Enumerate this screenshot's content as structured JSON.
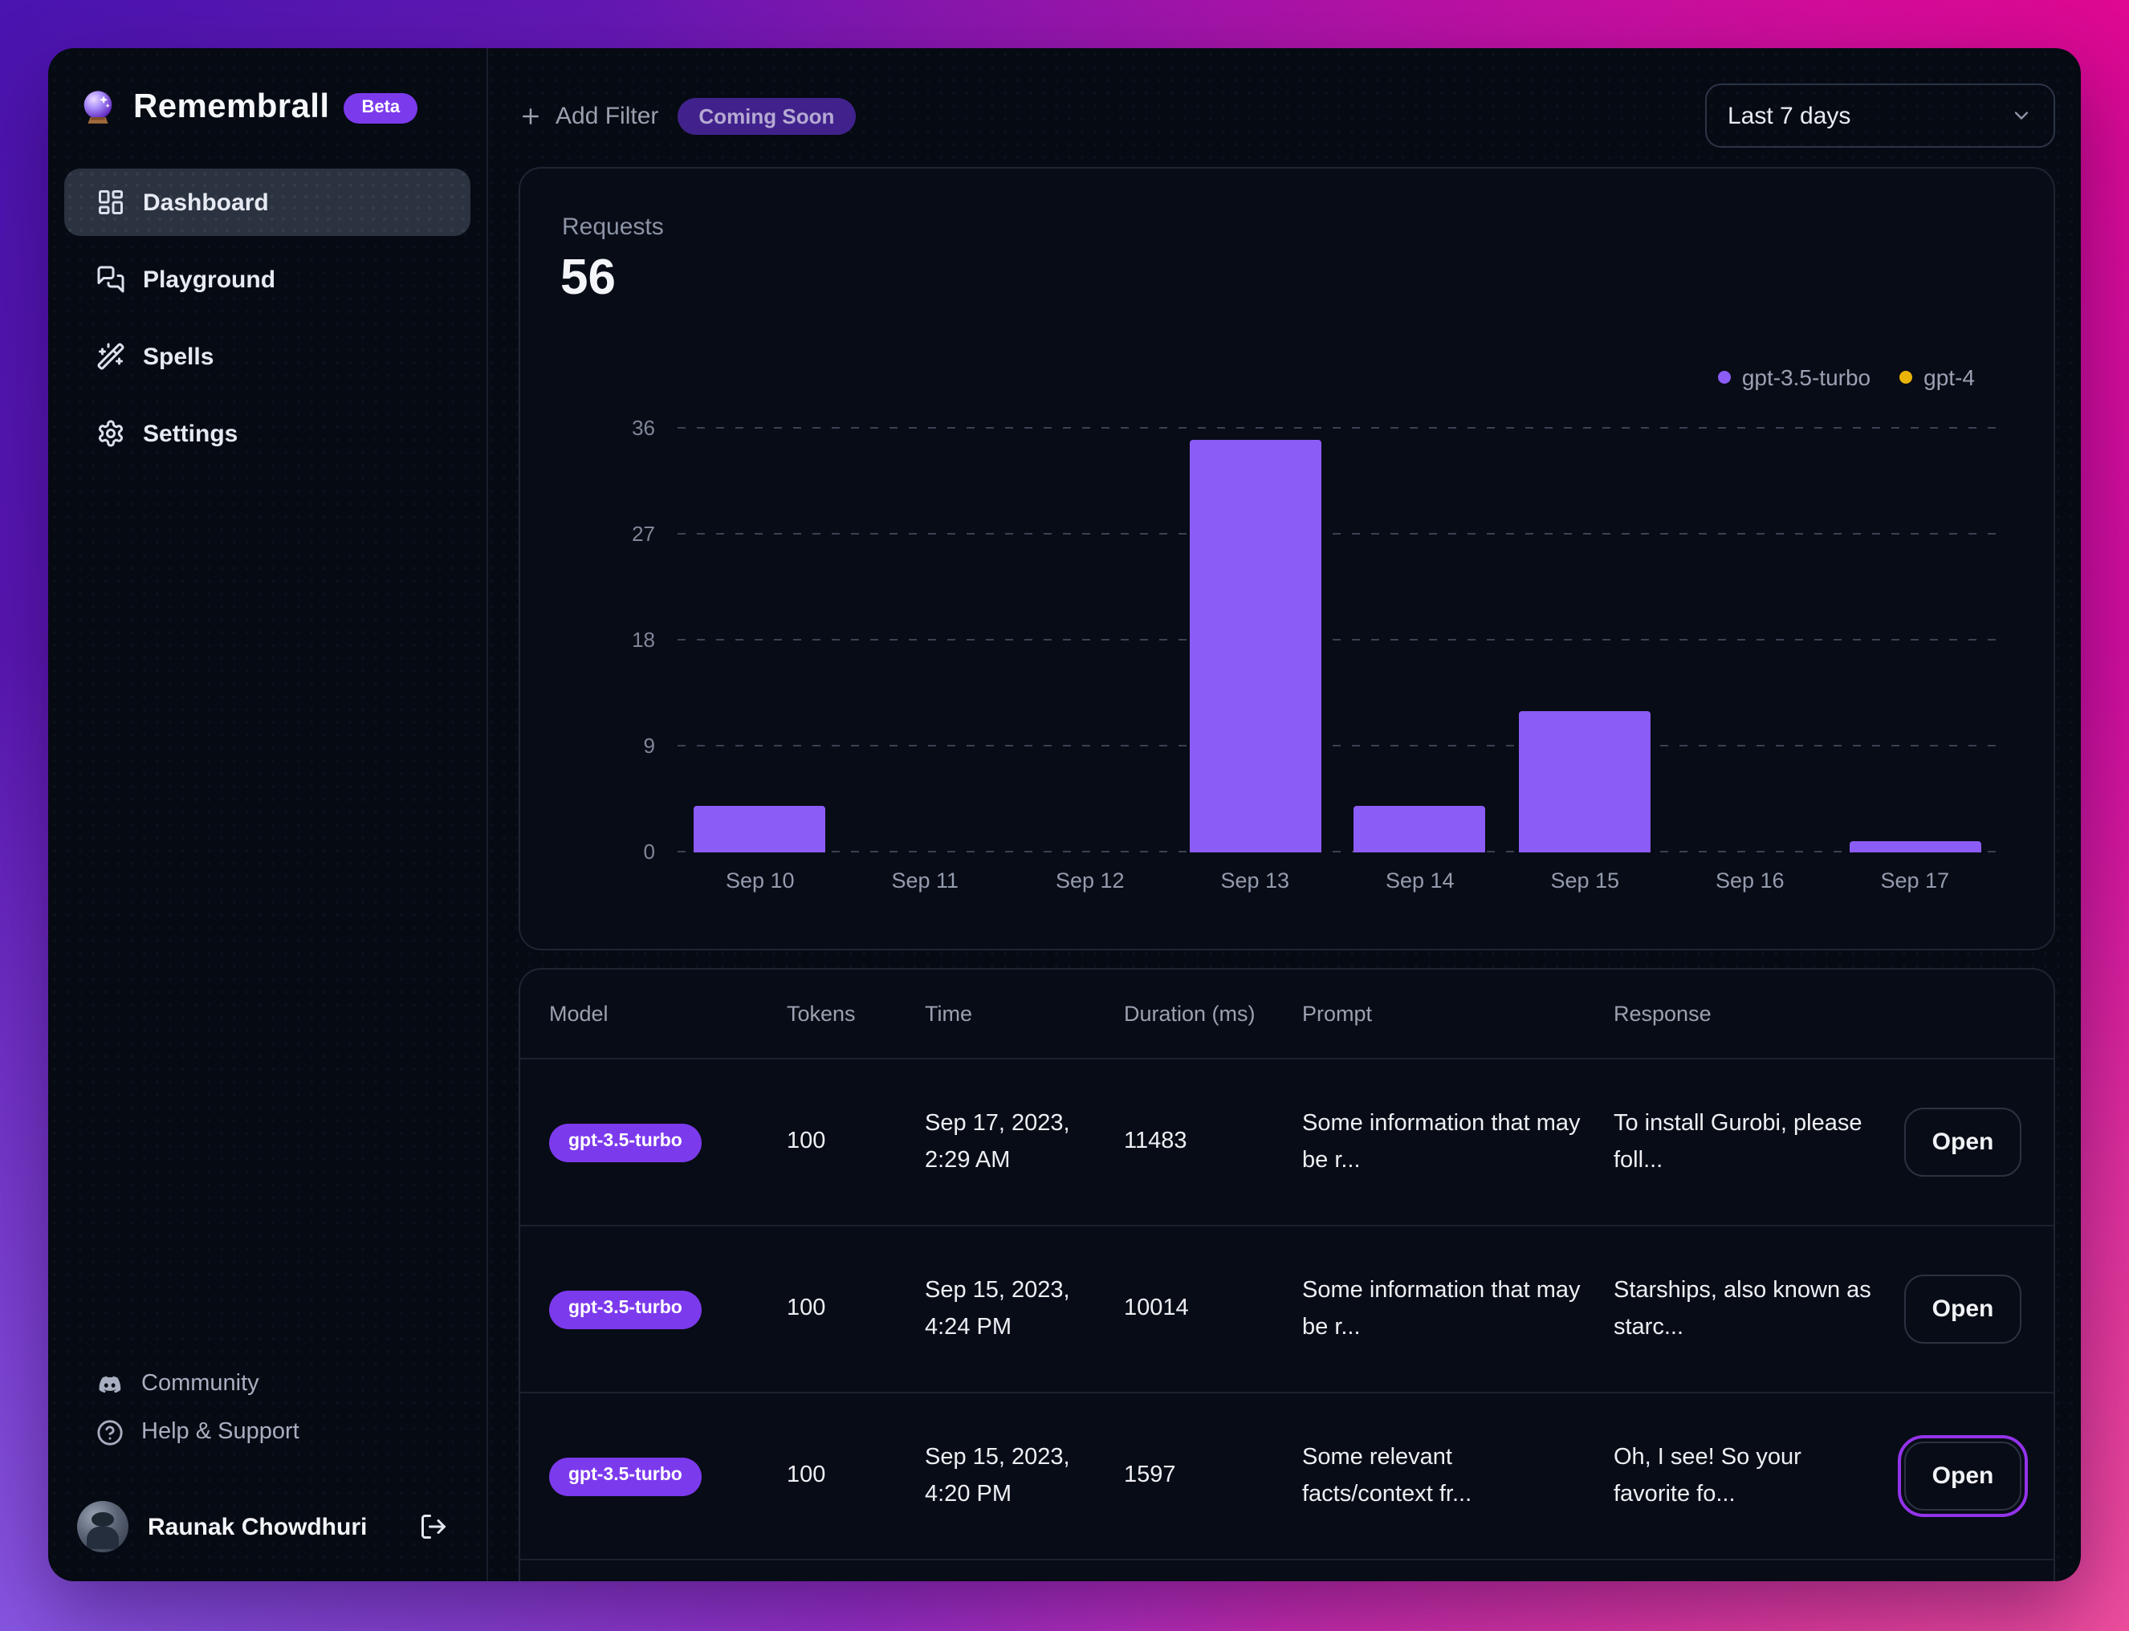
{
  "app": {
    "name": "Remembrall",
    "badge": "Beta"
  },
  "sidebar": {
    "nav": [
      {
        "label": "Dashboard",
        "icon": "dashboard-icon",
        "active": true
      },
      {
        "label": "Playground",
        "icon": "playground-icon",
        "active": false
      },
      {
        "label": "Spells",
        "icon": "spells-icon",
        "active": false
      },
      {
        "label": "Settings",
        "icon": "settings-icon",
        "active": false
      }
    ],
    "footer": [
      {
        "label": "Community",
        "icon": "discord-icon"
      },
      {
        "label": "Help & Support",
        "icon": "help-icon"
      }
    ],
    "user": {
      "name": "Raunak Chowdhuri"
    }
  },
  "topbar": {
    "add_filter": "Add Filter",
    "coming_soon": "Coming Soon",
    "date_range": "Last 7 days"
  },
  "chart_data": {
    "type": "bar",
    "title": "Requests",
    "total": "56",
    "categories": [
      "Sep 10",
      "Sep 11",
      "Sep 12",
      "Sep 13",
      "Sep 14",
      "Sep 15",
      "Sep 16",
      "Sep 17"
    ],
    "series": [
      {
        "name": "gpt-3.5-turbo",
        "color": "#8b5cf6",
        "values": [
          4,
          0,
          0,
          35,
          4,
          12,
          0,
          1
        ]
      },
      {
        "name": "gpt-4",
        "color": "#eab308",
        "values": [
          0,
          0,
          0,
          0,
          0,
          0,
          0,
          0
        ]
      }
    ],
    "ylim": [
      0,
      36
    ],
    "yticks": [
      0,
      9,
      18,
      27,
      36
    ],
    "grid": "horizontal-dashed",
    "legend_position": "top-right"
  },
  "table": {
    "columns": [
      "Model",
      "Tokens",
      "Time",
      "Duration (ms)",
      "Prompt",
      "Response",
      ""
    ],
    "open_label": "Open",
    "rows": [
      {
        "model": "gpt-3.5-turbo",
        "tokens": "100",
        "time": "Sep 17, 2023, 2:29 AM",
        "duration": "11483",
        "prompt": "Some information that may be r...",
        "response": "To install Gurobi, please foll...",
        "open_highlighted": false
      },
      {
        "model": "gpt-3.5-turbo",
        "tokens": "100",
        "time": "Sep 15, 2023, 4:24 PM",
        "duration": "10014",
        "prompt": "Some information that may be r...",
        "response": "Starships, also known as starc...",
        "open_highlighted": false
      },
      {
        "model": "gpt-3.5-turbo",
        "tokens": "100",
        "time": "Sep 15, 2023, 4:20 PM",
        "duration": "1597",
        "prompt": "Some relevant facts/context fr...",
        "response": "Oh, I see! So your favorite fo...",
        "open_highlighted": true
      }
    ]
  },
  "colors": {
    "accent": "#7c3aed",
    "bar_purple": "#8b5cf6",
    "gpt4_yellow": "#eab308",
    "gradient_start": "#4a14b0",
    "gradient_end": "#e0078f"
  }
}
